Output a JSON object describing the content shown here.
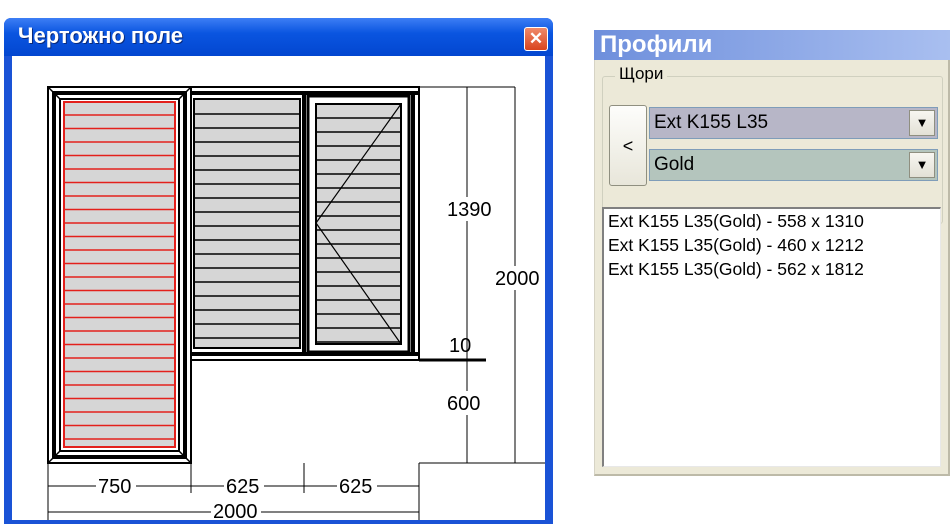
{
  "drawing_window": {
    "title": "Чертожно поле",
    "close_glyph": "✕",
    "dimensions": {
      "width_left": "750",
      "width_mid": "625",
      "width_right": "625",
      "width_total": "2000",
      "height_upper": "1390",
      "height_gap": "10",
      "height_lower": "600",
      "height_total": "2000"
    },
    "colors": {
      "shutter_highlight": "#e3201b",
      "panel_fill": "#d6d6d6"
    }
  },
  "profiles_window": {
    "title": "Профили",
    "group_label": "Щори",
    "back_button": "<",
    "profile_select": {
      "value": "Ext K155 L35"
    },
    "color_select": {
      "value": "Gold"
    },
    "items": [
      "Ext K155 L35(Gold) - 558 x 1310",
      "Ext K155 L35(Gold) - 460 x 1212",
      "Ext K155 L35(Gold) - 562 x 1812"
    ]
  }
}
